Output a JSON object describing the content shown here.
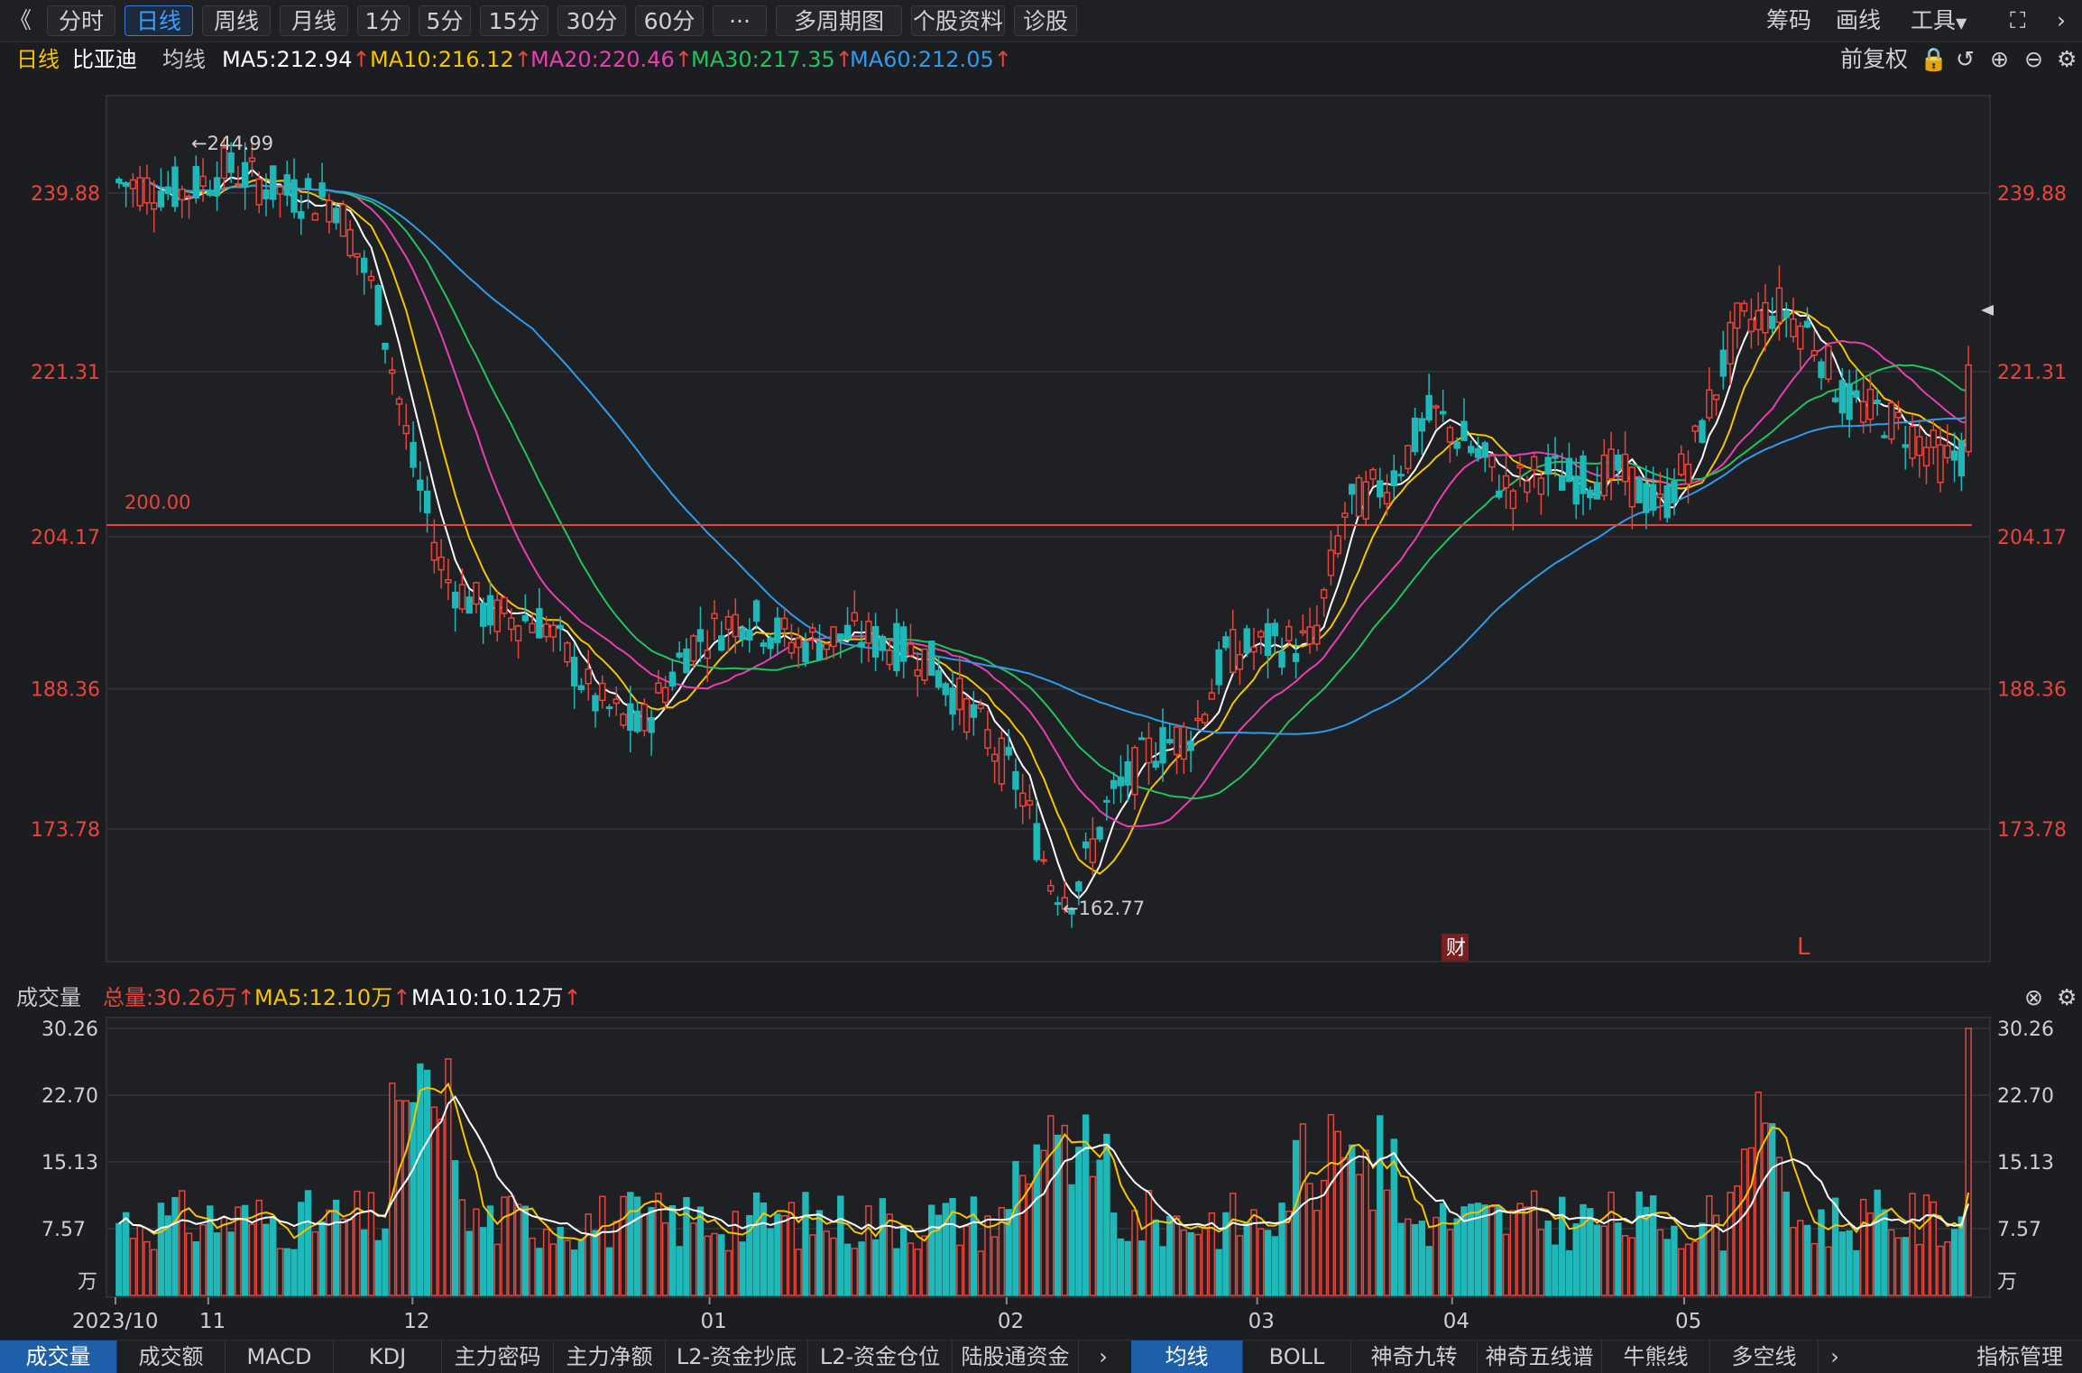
{
  "topbar": {
    "back_label": "《",
    "periods": [
      "分时",
      "日线",
      "周线",
      "月线",
      "1分",
      "5分",
      "15分",
      "30分",
      "60分",
      "···",
      "多周期图",
      "个股资料",
      "诊股"
    ],
    "active_period": "日线",
    "right": {
      "chips_label": "筹码",
      "draw_label": "画线",
      "tools_label": "工具"
    }
  },
  "legend": {
    "period": "日线",
    "stock": "比亚迪",
    "ma_title": "均线",
    "ma5": "MA5:212.94",
    "ma10": "MA10:216.12",
    "ma20": "MA20:220.46",
    "ma30": "MA30:217.35",
    "ma60": "MA60:212.05",
    "adjust": "前复权",
    "colors": {
      "ma5": "#ffffff",
      "ma10": "#f5c400",
      "ma20": "#e83fb0",
      "ma30": "#22c35e",
      "ma60": "#2f9bea",
      "up": "#e9443b",
      "down": "#1eb8b8"
    }
  },
  "price_axis": {
    "ticks": [
      "239.88",
      "221.31",
      "204.17",
      "188.36",
      "173.78"
    ]
  },
  "annotations": {
    "high": "←244.99",
    "low": "←162.77",
    "hline": "200.00",
    "badge_cai": "财",
    "badge_l": "L"
  },
  "volume_legend": {
    "title": "成交量",
    "total": "总量:30.26万",
    "ma5": "MA5:12.10万",
    "ma10": "MA10:10.12万"
  },
  "volume_axis": {
    "ticks": [
      "30.26",
      "22.70",
      "15.13",
      "7.57",
      "万"
    ]
  },
  "date_axis": [
    "2023/10",
    "11",
    "12",
    "01",
    "02",
    "03",
    "04",
    "05"
  ],
  "bottom_tabs_left": [
    "成交量",
    "成交额",
    "MACD",
    "KDJ",
    "主力密码",
    "主力净额",
    "L2-资金抄底",
    "L2-资金仓位",
    "陆股通资金"
  ],
  "bottom_tabs_right": [
    "均线",
    "BOLL",
    "神奇九转",
    "神奇五线谱",
    "牛熊线",
    "多空线"
  ],
  "bottom_right_label": "指标管理",
  "chart_data": [
    {
      "type": "candlestick",
      "title": "比亚迪 日线",
      "ylim": [
        160,
        250
      ],
      "yticks": [
        239.88,
        221.31,
        204.17,
        188.36,
        173.78
      ],
      "reference_line": 200.0,
      "high_marker": 244.99,
      "low_marker": 162.77,
      "months": [
        "2023/10",
        "11",
        "12",
        "01",
        "02",
        "03",
        "04",
        "05"
      ],
      "moving_averages_last": {
        "MA5": 212.94,
        "MA10": 216.12,
        "MA20": 220.46,
        "MA30": 217.35,
        "MA60": 212.05
      }
    },
    {
      "type": "bar",
      "title": "成交量",
      "unit": "万",
      "ylim": [
        0,
        30.26
      ],
      "yticks": [
        30.26,
        22.7,
        15.13,
        7.57
      ],
      "last_value": 30.26
    }
  ]
}
